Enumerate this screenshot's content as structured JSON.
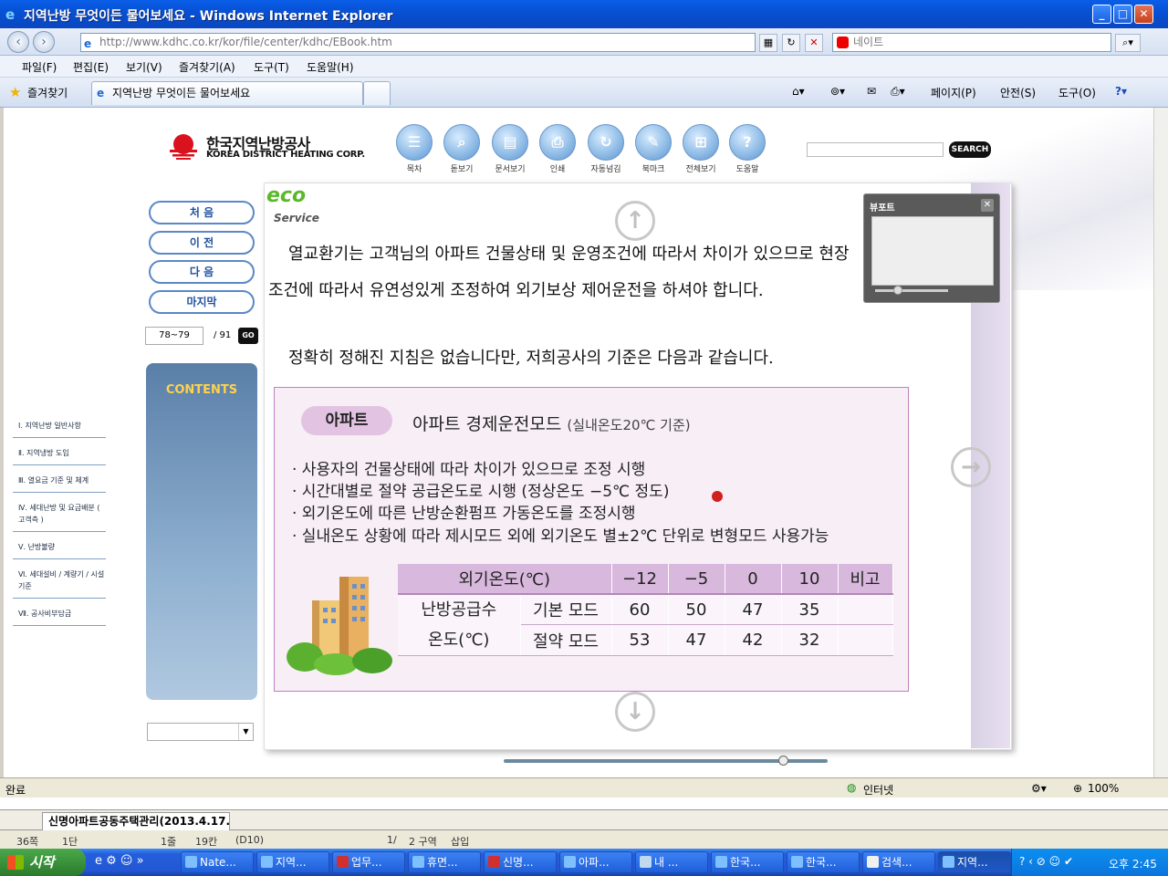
{
  "window": {
    "title": "지역난방 무엇이든 물어보세요 - Windows Internet Explorer",
    "min": "_",
    "max": "□",
    "close": "✕"
  },
  "address": {
    "url": "http://www.kdhc.co.kr/kor/file/center/kdhc/EBook.htm",
    "search_placeholder": "네이트"
  },
  "menu": [
    "파일(F)",
    "편집(E)",
    "보기(V)",
    "즐겨찾기(A)",
    "도구(T)",
    "도움말(H)"
  ],
  "tabs": {
    "favorites": "즐겨찾기",
    "active_tab": "지역난방 무엇이든 물어보세요",
    "commands": [
      "페이지(P)",
      "안전(S)",
      "도구(O)"
    ]
  },
  "site": {
    "logo_kr": "한국지역난방공사",
    "logo_en": "KOREA DISTRICT HEATING CORP.",
    "toolbar": [
      {
        "label": "목차",
        "icon": "toc-icon",
        "glyph": "☰"
      },
      {
        "label": "돋보기",
        "icon": "magnifier-icon",
        "glyph": "⌕"
      },
      {
        "label": "문서보기",
        "icon": "document-icon",
        "glyph": "▤"
      },
      {
        "label": "인쇄",
        "icon": "print-icon",
        "glyph": "⎙"
      },
      {
        "label": "자동넘김",
        "icon": "autoflip-icon",
        "glyph": "↻"
      },
      {
        "label": "북마크",
        "icon": "bookmark-icon",
        "glyph": "✎"
      },
      {
        "label": "전체보기",
        "icon": "grid-icon",
        "glyph": "⊞"
      },
      {
        "label": "도움말",
        "icon": "help-icon",
        "glyph": "?"
      }
    ],
    "search_button": "SEARCH",
    "nav": [
      "처 음",
      "이 전",
      "다 음",
      "마지막"
    ],
    "page_input": "78~79",
    "page_total": "/ 91",
    "go": "GO",
    "contents_title": "CONTENTS",
    "contents": [
      "Ⅰ. 지역난방 일반사항",
      "Ⅱ. 지역냉방 도입",
      "Ⅲ. 열요금 기준 및 체계",
      "Ⅳ. 세대난방 및 요금배분 ( 고객측 )",
      "Ⅴ. 난방불량",
      "Ⅵ. 세대설비 / 계량기 / 시설기준",
      "Ⅶ. 공사비부담금"
    ]
  },
  "page": {
    "eco": "eco",
    "eco_sub": "Service",
    "para1_line1": "열교환기는 고객님의 아파트 건물상태 및 운영조건에 따라서 차이가 있으므로 현장",
    "para1_line2": "조건에 따라서 유연성있게 조정하여 외기보상 제어운전을 하셔야 합니다.",
    "para2": "정확히 정해진 지침은 없습니다만, 저희공사의 기준은 다음과 같습니다.",
    "tag": "아파트",
    "panel_title": "아파트 경제운전모드",
    "panel_title_note": "(실내온도20℃ 기준)",
    "bullets": [
      "· 사용자의 건물상태에 따라 차이가 있으므로 조정 시행",
      "· 시간대별로 절약 공급온도로 시행 (정상온도 −5℃ 정도)",
      "· 외기온도에 따른 난방순환펌프 가동온도를 조정시행",
      "· 실내온도 상황에 따라 제시모드 외에 외기온도 별±2℃ 단위로 변형모드 사용가능"
    ],
    "table": {
      "header": [
        "외기온도(℃)",
        "−12",
        "−5",
        "0",
        "10",
        "비고"
      ],
      "row_group_line1": "난방공급수",
      "row_group_line2": "온도(℃)",
      "rows": [
        {
          "mode": "기본 모드",
          "values": [
            "60",
            "50",
            "47",
            "35"
          ],
          "note": ""
        },
        {
          "mode": "절약 모드",
          "values": [
            "53",
            "47",
            "42",
            "32"
          ],
          "note": ""
        }
      ]
    },
    "viewport_title": "뷰포트"
  },
  "status": {
    "left": "완료",
    "zone": "인터넷",
    "zoom": "100%"
  },
  "hwp": {
    "tab": "신명아파트공동주택관리(2013.4.17...",
    "status": [
      "36쪽",
      "1단",
      "1줄",
      "19칸",
      "(D10)",
      "1/",
      "2 구역",
      "삽입"
    ]
  },
  "taskbar": {
    "start": "시작",
    "items": [
      "Nate...",
      "지역...",
      "업무...",
      "휴면...",
      "신명...",
      "아파...",
      "내 ...",
      "한국...",
      "한국...",
      "검색...",
      "지역..."
    ],
    "time": "오후 2:45"
  }
}
